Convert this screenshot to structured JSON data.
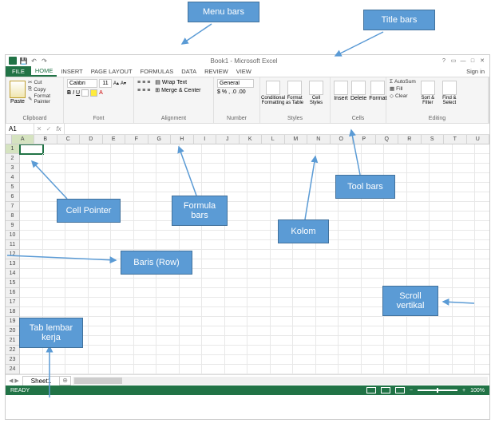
{
  "annotations": {
    "menu_bars": "Menu bars",
    "title_bars": "Title bars",
    "cell_pointer": "Cell Pointer",
    "formula_bars": "Formula bars",
    "tool_bars": "Tool bars",
    "kolom": "Kolom",
    "baris": "Baris (Row)",
    "tab_lembar": "Tab lembar kerja",
    "scroll_vertikal": "Scroll vertikal"
  },
  "title": "Book1 - Microsoft Excel",
  "signin": "Sign in",
  "menus": {
    "file": "FILE",
    "home": "HOME",
    "insert": "INSERT",
    "page_layout": "PAGE LAYOUT",
    "formulas": "FORMULAS",
    "data": "DATA",
    "review": "REVIEW",
    "view": "VIEW"
  },
  "ribbon": {
    "clipboard": {
      "label": "Clipboard",
      "paste": "Paste",
      "cut": "Cut",
      "copy": "Copy",
      "format_painter": "Format Painter"
    },
    "font": {
      "label": "Font",
      "name": "Calibri",
      "size": "11"
    },
    "alignment": {
      "label": "Alignment",
      "wrap": "Wrap Text",
      "merge": "Merge & Center"
    },
    "number": {
      "label": "Number",
      "format": "General"
    },
    "styles": {
      "label": "Styles",
      "cond": "Conditional Formatting",
      "table": "Format as Table",
      "cell": "Cell Styles"
    },
    "cells": {
      "label": "Cells",
      "insert": "Insert",
      "delete": "Delete",
      "format": "Format"
    },
    "editing": {
      "label": "Editing",
      "autosum": "AutoSum",
      "fill": "Fill",
      "clear": "Clear",
      "sort": "Sort & Filter",
      "find": "Find & Select"
    }
  },
  "name_box": "A1",
  "fx": "fx",
  "columns": [
    "A",
    "B",
    "C",
    "D",
    "E",
    "F",
    "G",
    "H",
    "I",
    "J",
    "K",
    "L",
    "M",
    "N",
    "O",
    "P",
    "Q",
    "R",
    "S",
    "T",
    "U"
  ],
  "rows": [
    "1",
    "2",
    "3",
    "4",
    "5",
    "6",
    "7",
    "8",
    "9",
    "10",
    "11",
    "12",
    "13",
    "14",
    "15",
    "16",
    "17",
    "18",
    "19",
    "20",
    "21",
    "22",
    "23",
    "24"
  ],
  "sheet": "Sheet1",
  "status": "READY",
  "zoom": "100%"
}
